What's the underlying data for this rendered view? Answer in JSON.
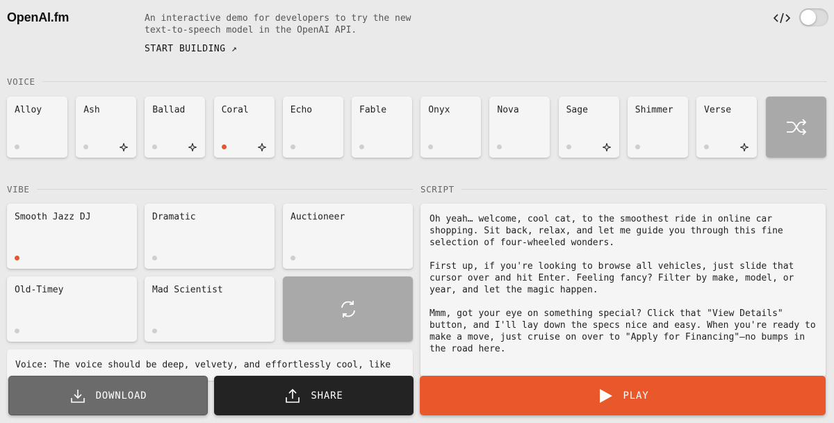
{
  "header": {
    "logo": "OpenAI.fm",
    "tagline": "An interactive demo for developers to try the new text-to-speech model in the OpenAI API.",
    "start_building": "START BUILDING ↗",
    "code_icon": "code-icon",
    "dev_mode_toggle": false
  },
  "voice": {
    "label": "VOICE",
    "items": [
      {
        "name": "Alloy",
        "selected": false,
        "new": false
      },
      {
        "name": "Ash",
        "selected": false,
        "new": true
      },
      {
        "name": "Ballad",
        "selected": false,
        "new": true
      },
      {
        "name": "Coral",
        "selected": true,
        "new": true
      },
      {
        "name": "Echo",
        "selected": false,
        "new": false
      },
      {
        "name": "Fable",
        "selected": false,
        "new": false
      },
      {
        "name": "Onyx",
        "selected": false,
        "new": false
      },
      {
        "name": "Nova",
        "selected": false,
        "new": false
      },
      {
        "name": "Sage",
        "selected": false,
        "new": true
      },
      {
        "name": "Shimmer",
        "selected": false,
        "new": false
      },
      {
        "name": "Verse",
        "selected": false,
        "new": true
      }
    ],
    "shuffle_icon": "shuffle-icon"
  },
  "vibe": {
    "label": "VIBE",
    "items": [
      {
        "name": "Smooth Jazz DJ",
        "selected": true
      },
      {
        "name": "Dramatic",
        "selected": false
      },
      {
        "name": "Auctioneer",
        "selected": false
      },
      {
        "name": "Old-Timey",
        "selected": false
      },
      {
        "name": "Mad Scientist",
        "selected": false
      }
    ],
    "refresh_icon": "refresh-icon",
    "description": "Voice: The voice should be deep, velvety, and effortlessly cool, like"
  },
  "script": {
    "label": "SCRIPT",
    "paragraphs": [
      "Oh yeah… welcome, cool cat, to the smoothest ride in online car shopping. Sit back, relax, and let me guide you through this fine selection of four-wheeled wonders.",
      "First up, if you're looking to browse all vehicles, just slide that cursor over and hit Enter. Feeling fancy? Filter by make, model, or year, and let the magic happen.",
      "Mmm, got your eye on something special? Click that \"View Details\" button, and I'll lay down the specs nice and easy. When you're ready to make a move, just cruise on over to \"Apply for Financing\"—no bumps in the road here."
    ]
  },
  "actions": {
    "download": "DOWNLOAD",
    "share": "SHARE",
    "play": "PLAY"
  },
  "colors": {
    "accent": "#e8582a",
    "selected_dot": "#e4572e",
    "share_bg": "#232323",
    "download_bg": "#6b6b6b"
  }
}
